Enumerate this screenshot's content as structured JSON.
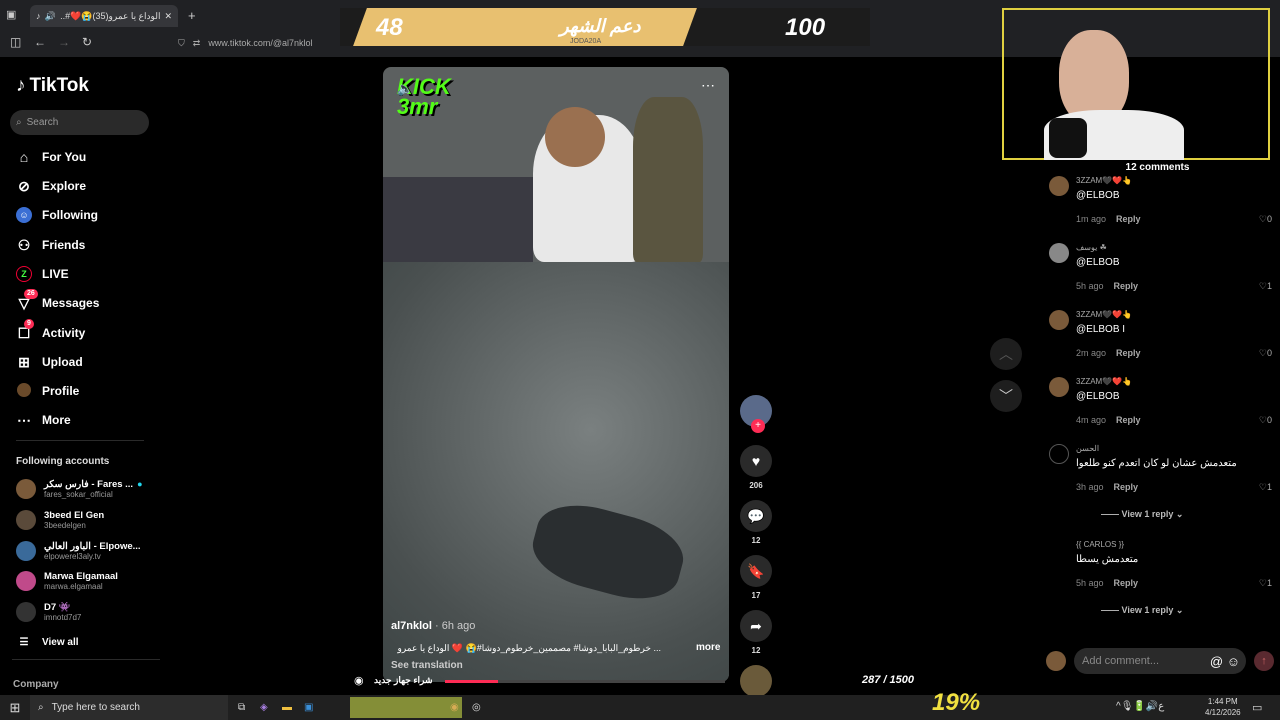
{
  "browser": {
    "tab_title": "الوداع يا عمرو(35)😭❤️#...",
    "url": "www.tiktok.com/@al7nklol",
    "url_overlay": "JODA20A"
  },
  "stream_goal": {
    "left_value": "48",
    "label": "دعم الشهر",
    "right_value": "100"
  },
  "sidebar": {
    "logo": "TikTok",
    "search_placeholder": "Search",
    "nav": [
      {
        "label": "For You",
        "icon": "home-icon"
      },
      {
        "label": "Explore",
        "icon": "compass-icon"
      },
      {
        "label": "Following",
        "icon": "following-icon"
      },
      {
        "label": "Friends",
        "icon": "friends-icon"
      },
      {
        "label": "LIVE",
        "icon": "live-icon"
      },
      {
        "label": "Messages",
        "icon": "messages-icon",
        "badge": "26"
      },
      {
        "label": "Activity",
        "icon": "activity-icon",
        "badge": "9"
      },
      {
        "label": "Upload",
        "icon": "upload-icon"
      },
      {
        "label": "Profile",
        "icon": "profile-icon"
      },
      {
        "label": "More",
        "icon": "more-icon"
      }
    ],
    "following_header": "Following accounts",
    "accounts": [
      {
        "name": "فارس سكر - Fares ...",
        "user": "fares_sokar_official"
      },
      {
        "name": "3beed El Gen",
        "user": "3beedelgen"
      },
      {
        "name": "الباور العالي - Elpowe...",
        "user": "elpowerel3aly.tv"
      },
      {
        "name": "Marwa Elgamaal",
        "user": "marwa.elgamaal"
      },
      {
        "name": "D7 👾",
        "user": "imnotd7d7"
      }
    ],
    "view_all": "View all",
    "company": "Company"
  },
  "video": {
    "logo_text": "KICK 3mr",
    "author": "al7nklol",
    "time": "6h ago",
    "caption": "... خرطوم_البابا_دوشا# مصممين_خرطوم_دوشا#😭 ❤️ الوداع يا عمرو",
    "more": "more",
    "see_translation": "See translation",
    "likes": "206",
    "comments": "12",
    "saves": "17",
    "shares": "12"
  },
  "comments_panel": {
    "title": "12 comments",
    "items": [
      {
        "name": "3ZZAM🖤❤️👆",
        "text": "@ELBOB",
        "time": "1m ago",
        "likes": "0"
      },
      {
        "name": "يوسف ☘",
        "text": "@ELBOB",
        "time": "5h ago",
        "likes": "1"
      },
      {
        "name": "3ZZAM🖤❤️👆",
        "text": "@ELBOB I",
        "time": "2m ago",
        "likes": "0"
      },
      {
        "name": "3ZZAM🖤❤️👆",
        "text": "@ELBOB",
        "time": "4m ago",
        "likes": "0"
      },
      {
        "name": "الحسن",
        "text": "متعدمش عشان لو كان اتعدم كنو طلعوا",
        "time": "3h ago",
        "likes": "1"
      },
      {
        "name": "{{ CARLOS }}",
        "text": "متعدمش يسطا",
        "time": "5h ago",
        "likes": "1"
      }
    ],
    "reply": "Reply",
    "view_reply": "View 1 reply",
    "add_placeholder": "Add comment..."
  },
  "overlay_bottom": {
    "label": "شراء جهاز جديد",
    "progress_text": "287 / 1500",
    "percent": "19%",
    "progress": 0.19
  },
  "taskbar": {
    "search": "Type here to search",
    "time": "1:44 PM",
    "date": "4/12/2026"
  }
}
